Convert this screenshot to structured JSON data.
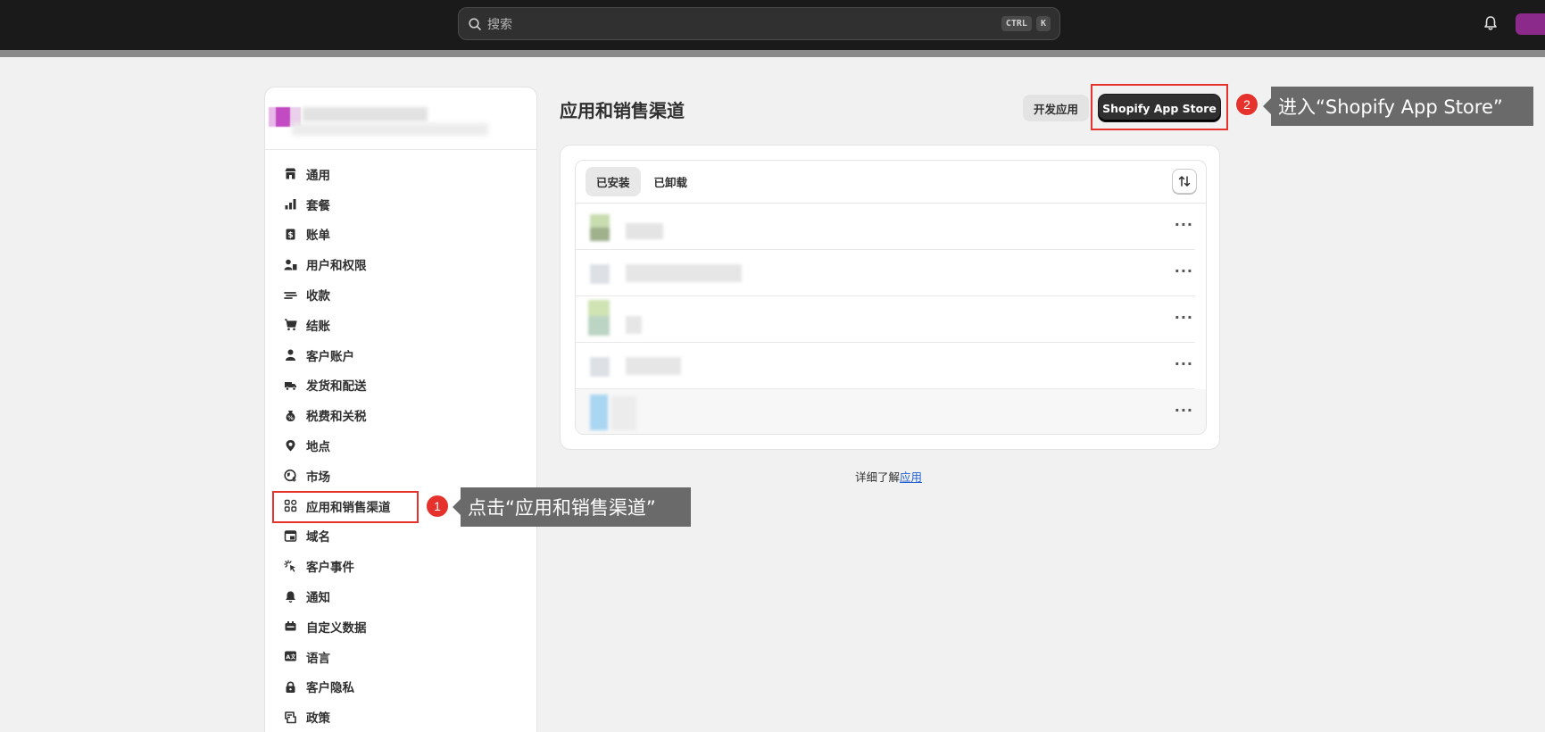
{
  "topbar": {
    "search_placeholder": "搜索",
    "shortcut_keys": [
      "CTRL",
      "K"
    ]
  },
  "sidebar": {
    "items": [
      {
        "label": "通用",
        "icon": "store-icon"
      },
      {
        "label": "套餐",
        "icon": "plan-chart-icon"
      },
      {
        "label": "账单",
        "icon": "bill-icon"
      },
      {
        "label": "用户和权限",
        "icon": "users-icon"
      },
      {
        "label": "收款",
        "icon": "payment-icon"
      },
      {
        "label": "结账",
        "icon": "cart-icon"
      },
      {
        "label": "客户账户",
        "icon": "person-icon"
      },
      {
        "label": "发货和配送",
        "icon": "truck-icon"
      },
      {
        "label": "税费和关税",
        "icon": "tax-bag-icon"
      },
      {
        "label": "地点",
        "icon": "location-pin-icon"
      },
      {
        "label": "市场",
        "icon": "globe-icon"
      },
      {
        "label": "应用和销售渠道",
        "icon": "apps-icon"
      },
      {
        "label": "域名",
        "icon": "domain-icon"
      },
      {
        "label": "客户事件",
        "icon": "cursor-click-icon"
      },
      {
        "label": "通知",
        "icon": "bell-icon"
      },
      {
        "label": "自定义数据",
        "icon": "database-icon"
      },
      {
        "label": "语言",
        "icon": "language-icon"
      },
      {
        "label": "客户隐私",
        "icon": "lock-icon"
      },
      {
        "label": "政策",
        "icon": "policy-icon"
      }
    ]
  },
  "main": {
    "title": "应用和销售渠道",
    "dev_apps_button": "开发应用",
    "app_store_button": "Shopify App Store",
    "tabs": [
      "已安装",
      "已卸载"
    ],
    "apps_more_label": "···",
    "learn_more_prefix": "详细了解",
    "learn_more_link": "应用"
  },
  "callouts": [
    {
      "number": "1",
      "text": "点击“应用和销售渠道”"
    },
    {
      "number": "2",
      "text": "进入“Shopify App Store”"
    }
  ],
  "colors": {
    "topbar": "#1a1a1a",
    "background": "#f1f1f1",
    "highlight_red": "#e5322d",
    "primary_button": "#303030",
    "link": "#2463d1"
  }
}
